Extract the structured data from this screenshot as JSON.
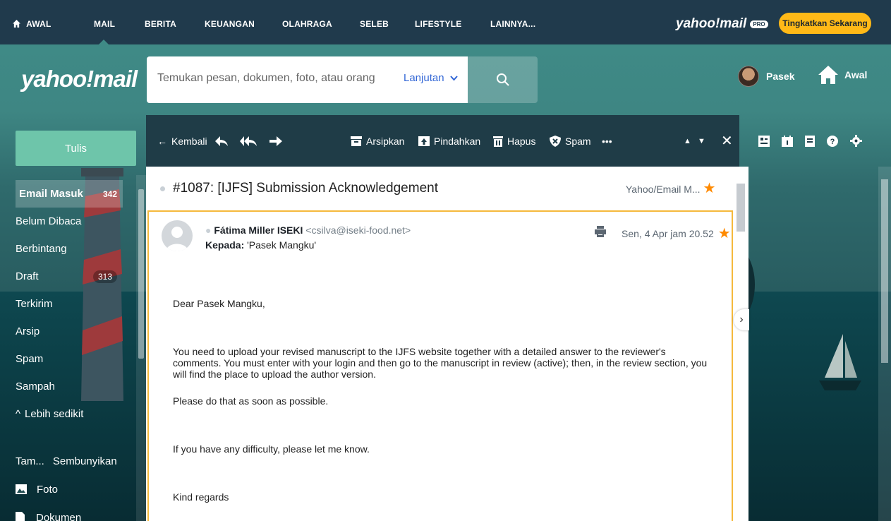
{
  "topnav": {
    "items": [
      "AWAL",
      "MAIL",
      "BERITA",
      "KEUANGAN",
      "OLAHRAGA",
      "SELEB",
      "LIFESTYLE",
      "LAINNYA..."
    ],
    "brand": "yahoo!mail",
    "pro_badge": "PRO",
    "upgrade": "Tingkatkan Sekarang"
  },
  "header": {
    "logo": "yahoo!mail",
    "search_placeholder": "Temukan pesan, dokumen, foto, atau orang",
    "advanced": "Lanjutan",
    "profile_name": "Pasek",
    "home": "Awal"
  },
  "sidebar": {
    "compose": "Tulis",
    "folders": [
      {
        "label": "Email Masuk",
        "count": "342"
      },
      {
        "label": "Belum Dibaca",
        "count": ""
      },
      {
        "label": "Berbintang",
        "count": ""
      },
      {
        "label": "Draft",
        "count": "313"
      },
      {
        "label": "Terkirim",
        "count": ""
      },
      {
        "label": "Arsip",
        "count": ""
      },
      {
        "label": "Spam",
        "count": ""
      },
      {
        "label": "Sampah",
        "count": ""
      }
    ],
    "less": "Lebih sedikit",
    "views_show": "Tam...",
    "views_hide": "Sembunyikan",
    "photos": "Foto",
    "docs": "Dokumen"
  },
  "toolbar": {
    "back": "Kembali",
    "archive": "Arsipkan",
    "move": "Pindahkan",
    "delete": "Hapus",
    "spam": "Spam",
    "more": "•••"
  },
  "message": {
    "subject": "#1087: [IJFS] Submission Acknowledgement",
    "folder": "Yahoo/Email M...",
    "sender_name": "Fátima Miller ISEKI",
    "sender_email": "<csilva@iseki-food.net>",
    "to_label": "Kepada:",
    "to_value": "'Pasek Mangku'",
    "date": "Sen, 4 Apr jam 20.52",
    "body": {
      "greeting": "Dear Pasek Mangku,",
      "p1": "You need to upload your revised manuscript to the IJFS website together with a detailed answer to the reviewer's comments. You must enter with your login and then go to the manuscript in review (active); then, in the review section, you will find the place to upload the author version.",
      "p2": "Please do that as soon as possible.",
      "p3": "If you have any difficulty, please let me know.",
      "closing": "Kind regards"
    }
  },
  "colors": {
    "accent_orange": "#ff8a00",
    "upgrade_yellow": "#ffb917",
    "compose_green": "#6ec5aa",
    "nav_dark": "#203a4c"
  }
}
